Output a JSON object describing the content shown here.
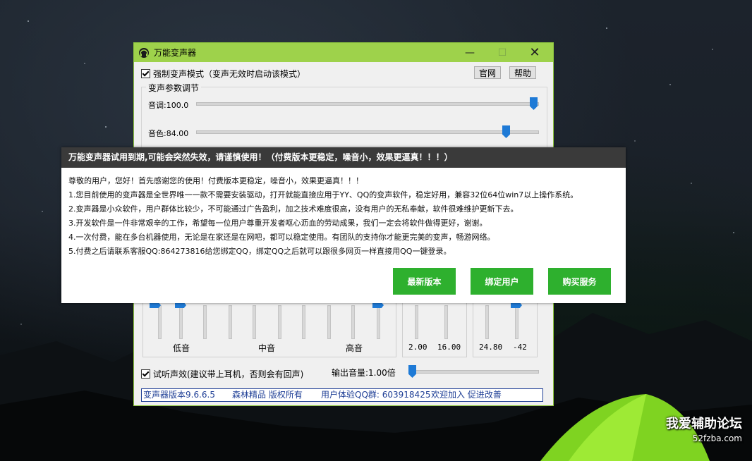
{
  "app": {
    "title": "万能变声器",
    "force_mode_label": "强制变声模式（变声无效时启动该模式）",
    "official_site_button": "官网",
    "help_button": "帮助",
    "params_group_title": "变声参数调节",
    "pitch_label": "音调:100.0",
    "pitch_value": 100.0,
    "timbre_label": "音色:84.00",
    "timbre_value": 84.0,
    "eq_labels": {
      "low": "低音",
      "mid": "中音",
      "high": "高音"
    },
    "box1_values": [
      "2.00",
      "16.00"
    ],
    "box2_values": [
      "24.80",
      "-42"
    ],
    "preview_label": "试听声效(建议带上耳机，否则会有回声)",
    "output_volume_label": "输出音量:1.00倍",
    "status": {
      "version": "变声器版本9.6.6.5",
      "copyright": "森林精品 版权所有",
      "qq_group": "用户体验QQ群: 603918425",
      "welcome": "欢迎加入 促进改善"
    }
  },
  "dialog": {
    "header": "万能变声器试用到期,可能会突然失效，请谨慎使用！（付费版本更稳定，噪音小，效果更逼真！！！）",
    "lines": [
      "尊敬的用户，您好！首先感谢您的使用！付费版本更稳定，噪音小，效果更逼真！！！",
      "1.您目前使用的变声器是全世界唯一一款不需要安装驱动，打开就能直接应用于YY、QQ的变声软件，稳定好用，兼容32位64位win7以上操作系统。",
      "2.变声器是小众软件，用户群体比较少，不可能通过广告盈利，加之技术难度很高，没有用户的无私奉献，软件很难维护更新下去。",
      "3.开发软件是一件非常艰辛的工作，希望每一位用户尊重开发者呕心沥血的劳动成果，我们一定会将软件做得更好，谢谢。",
      "4.一次付费，能在多台机器使用，无论是在家还是在网吧，都可以稳定使用。有团队的支持你才能更完美的变声，畅游网络。",
      "5.付费之后请联系客服QQ:864273816给您绑定QQ，绑定QQ之后就可以跟很多网页一样直接用QQ一键登录。"
    ],
    "buttons": {
      "latest": "最新版本",
      "bind": "绑定用户",
      "buy": "购买服务"
    }
  },
  "watermark": {
    "line1": "我爱辅助论坛",
    "line2": "52fzba.com"
  },
  "colors": {
    "titlebar": "#9ed24b",
    "dialog_header": "#3a3a3a",
    "green_button": "#2eb02e",
    "accent_blue": "#1e7ad6"
  }
}
